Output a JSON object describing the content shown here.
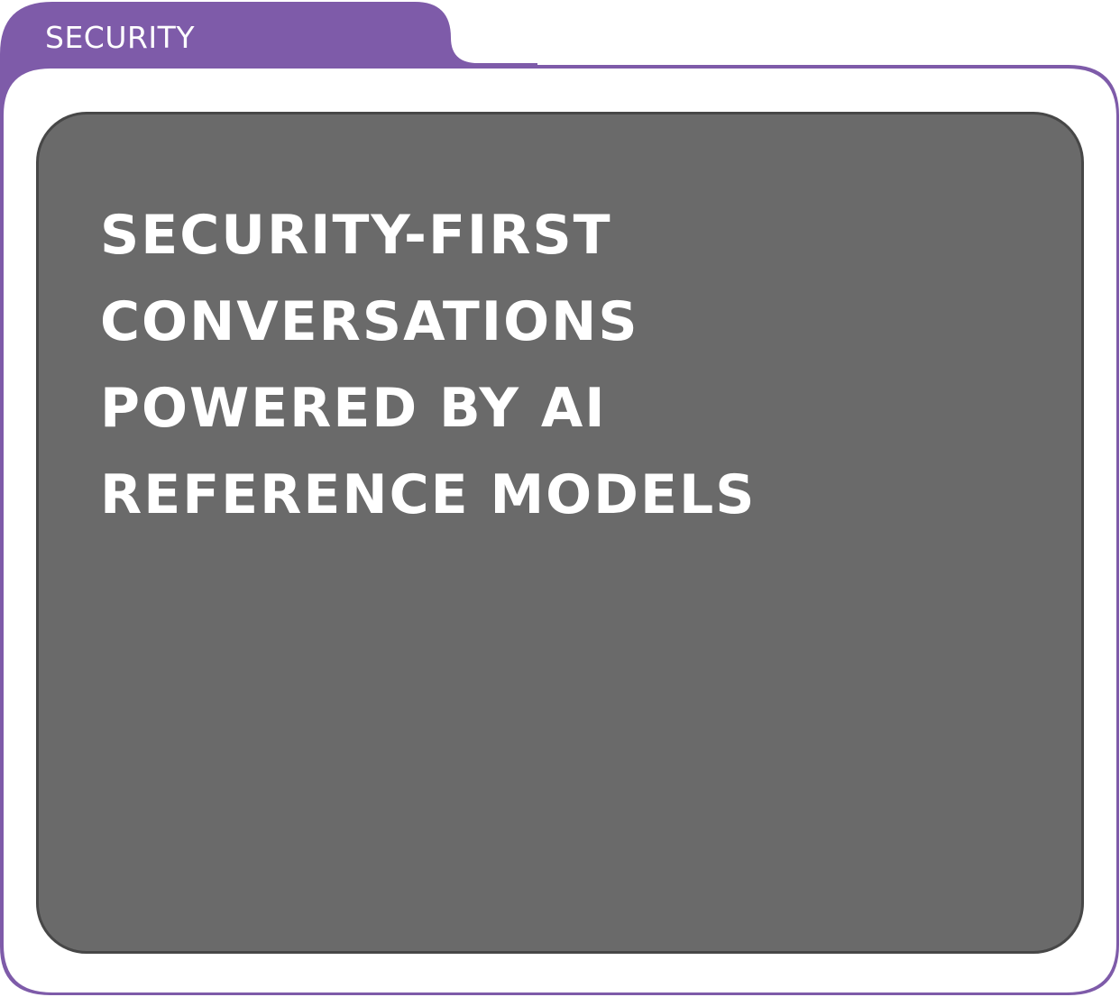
{
  "folder": {
    "tab_label": "SECURITY",
    "accent_color": "#7e5ba9"
  },
  "panel": {
    "background_color": "#6a6a6a",
    "headline_lines": [
      "SECURITY-FIRST",
      "CONVERSATIONS",
      "POWERED BY AI",
      "REFERENCE MODELS"
    ]
  }
}
